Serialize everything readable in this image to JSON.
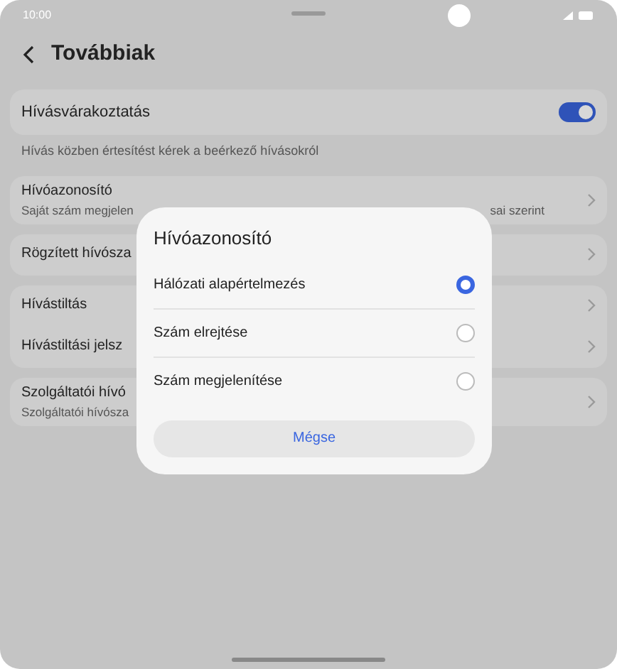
{
  "status_bar": {
    "time": "10:00"
  },
  "header": {
    "title": "Továbbiak"
  },
  "call_waiting": {
    "label": "Hívásvárakoztatás",
    "on": true,
    "description": "Hívás közben értesítést kérek a beérkező hívásokról"
  },
  "groups": [
    {
      "items": [
        {
          "title": "Hívóazonosító",
          "subtitle": "Saját szám megjelen",
          "subtitle_tail": "sai szerint"
        }
      ]
    },
    {
      "items": [
        {
          "title": "Rögzített hívósza"
        }
      ]
    },
    {
      "items": [
        {
          "title": "Hívástiltás"
        },
        {
          "title": "Hívástiltási jelsz"
        }
      ]
    },
    {
      "items": [
        {
          "title": "Szolgáltatói hívó",
          "subtitle": "Szolgáltatói hívósza"
        }
      ]
    }
  ],
  "dialog": {
    "title": "Hívóazonosító",
    "options": [
      {
        "label": "Hálózati alapértelmezés",
        "selected": true
      },
      {
        "label": "Szám elrejtése",
        "selected": false
      },
      {
        "label": "Szám megjelenítése",
        "selected": false
      }
    ],
    "cancel": "Mégse"
  }
}
